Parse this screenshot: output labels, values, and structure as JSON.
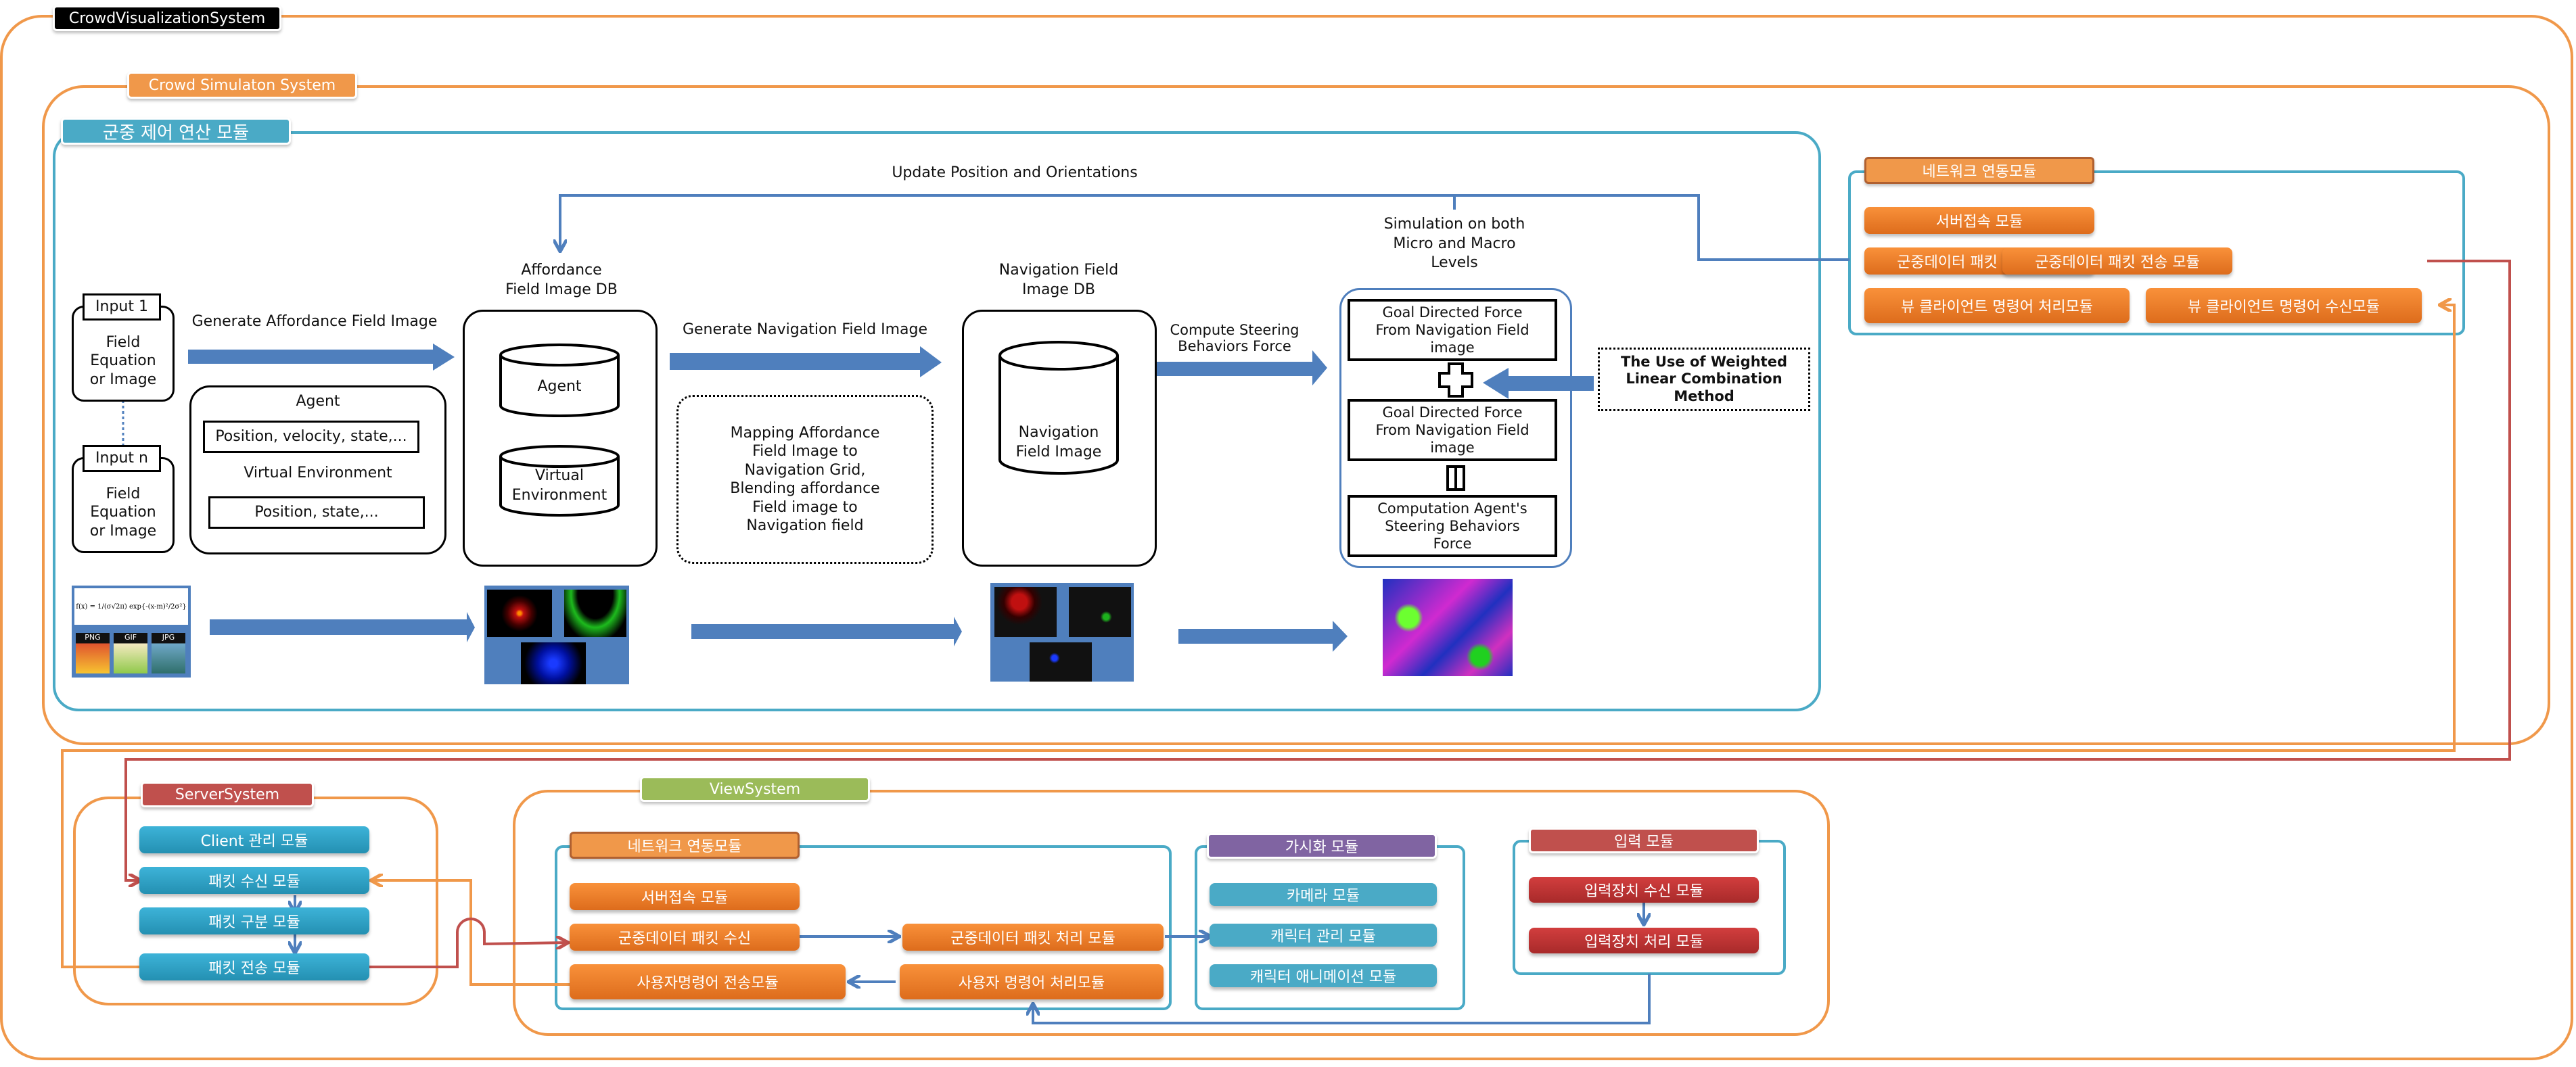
{
  "system": {
    "title": "CrowdVisualizationSystem",
    "colors": {
      "frame_orange": "#f0984a",
      "frame_blue": "#4aaac6",
      "arrow_blue": "#4f7fbd",
      "red_line": "#c0504d"
    }
  },
  "crowd_sim": {
    "title": "Crowd Simulaton System",
    "control_module": {
      "title": "군중 제어 연산 모듈",
      "update_label": "Update Position and Orientations",
      "input1": {
        "tag": "Input 1",
        "body": "Field\nEquation\nor Image"
      },
      "inputn": {
        "tag": "Input n",
        "body": "Field\nEquation\nor Image"
      },
      "gen_affordance_label": "Generate Affordance Field Image",
      "agent_panel": {
        "agent_label": "Agent",
        "agent_fields": "Position, velocity, state,...",
        "env_label": "Virtual Environment",
        "env_fields": "Position, state,..."
      },
      "affordance_db": {
        "title": "Affordance\nField Image DB",
        "cyl1": "Agent",
        "cyl2": "Virtual\nEnvironment"
      },
      "gen_nav_label": "Generate Navigation Field Image",
      "mapping_note": "Mapping Affordance\nField Image to\nNavigation Grid,\nBlending affordance\nField image to\nNavigation field",
      "nav_db": {
        "title": "Navigation Field\nImage DB",
        "cyl": "Navigation\nField Image"
      },
      "compute_label": "Compute Steering\nBehaviors Force",
      "sim_label": "Simulation on both\nMicro and Macro\nLevels",
      "force1": "Goal Directed Force\nFrom Navigation Field\nimage",
      "force2": "Goal Directed Force\nFrom Navigation Field\nimage",
      "force3": "Computation Agent's\nSteering Behaviors\nForce",
      "weighted_note": "The Use of Weighted\nLinear Combination\nMethod",
      "thumbs": {
        "formula": "f(x) = 1/(σ√2π) exp{-(x-m)²/2σ²}",
        "formats": [
          "PNG",
          "GIF",
          "JPG"
        ]
      }
    },
    "network_module": {
      "title": "네트워크 연동모듈",
      "server_connect": "서버접속 모듈",
      "packet_create": "군중데이터 패킷 생성 모듈",
      "packet_send": "군중데이터 패킷 전송 모듈",
      "cmd_process": "뷰 클라이언트 명령어 처리모듈",
      "cmd_receive": "뷰 클라이언트 명령어 수신모듈"
    }
  },
  "server_system": {
    "title": "ServerSystem",
    "modules": [
      "Client 관리 모듈",
      "패킷 수신 모듈",
      "패킷 구분 모듈",
      "패킷 전송 모듈"
    ]
  },
  "view_system": {
    "title": "ViewSystem",
    "network": {
      "title": "네트워크 연동모듈",
      "server_connect": "서버접속 모듈",
      "packet_recv": "군중데이터 패킷 수신",
      "packet_proc": "군중데이터 패킷 처리 모듈",
      "cmd_send": "사용자명령어 전송모듈",
      "cmd_proc": "사용자 명령어 처리모듈"
    },
    "visual": {
      "title": "가시화 모듈",
      "modules": [
        "카메라 모듈",
        "캐릭터 관리 모듈",
        "캐릭터 애니메이션 모듈"
      ]
    },
    "input": {
      "title": "입력 모듈",
      "modules": [
        "입력장치 수신 모듈",
        "입력장치 처리 모듈"
      ]
    }
  }
}
